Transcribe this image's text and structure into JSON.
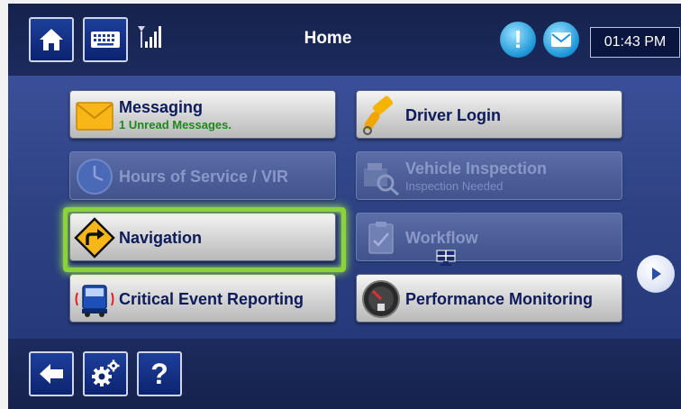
{
  "header": {
    "title": "Home",
    "clock": "01:43 PM",
    "alert_symbol": "!"
  },
  "tiles": [
    {
      "label": "Messaging",
      "subtext": "1 Unread Messages.",
      "enabled": true,
      "icon": "envelope-icon"
    },
    {
      "label": "Driver Login",
      "enabled": true,
      "icon": "key-icon"
    },
    {
      "label": "Hours of Service / VIR",
      "enabled": false,
      "icon": "clock-icon"
    },
    {
      "label": "Vehicle Inspection",
      "subtext": "Inspection Needed",
      "enabled": false,
      "icon": "truck-search-icon"
    },
    {
      "label": "Navigation",
      "enabled": true,
      "selected": true,
      "icon": "road-sign-turn-icon"
    },
    {
      "label": "Workflow",
      "enabled": false,
      "icon": "clipboard-icon"
    },
    {
      "label": "Critical Event Reporting",
      "enabled": true,
      "icon": "truck-alert-icon"
    },
    {
      "label": "Performance Monitoring",
      "enabled": true,
      "icon": "gauge-icon"
    }
  ],
  "footer": {
    "help_symbol": "?"
  },
  "colors": {
    "accent_selected": "#8bd33a",
    "unread_text": "#1d8a1d",
    "label_text": "#0d1b5a"
  }
}
